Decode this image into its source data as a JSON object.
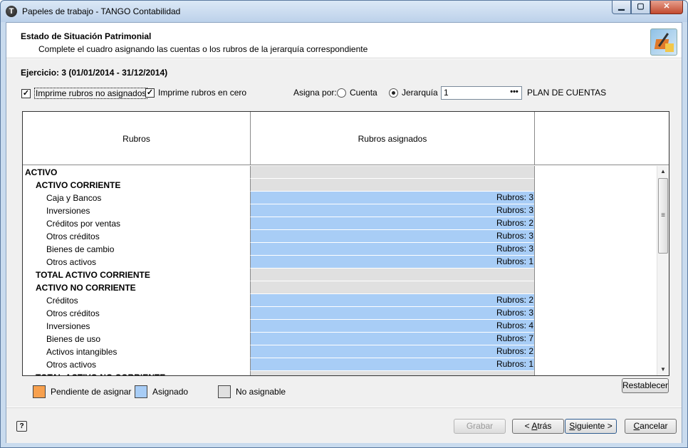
{
  "window": {
    "title": "Papeles de trabajo - TANGO Contabilidad",
    "icon": "tango-app-icon",
    "controls": {
      "minimize": "▁",
      "maximize": "▢",
      "close": "✕"
    }
  },
  "header": {
    "title": "Estado de Situación Patrimonial",
    "subtitle": "Complete el cuadro asignando las cuentas o los rubros de la jerarquía correspondiente"
  },
  "ejercicio": "Ejercicio: 3 (01/01/2014 - 31/12/2014)",
  "options": {
    "imprime_no_asignados": {
      "label": "Imprime rubros no asignados",
      "checked": true,
      "mark": "✓"
    },
    "imprime_en_cero": {
      "label": "Imprime rubros en cero",
      "checked": true,
      "mark": "✓"
    },
    "asigna_por_label": "Asigna por:",
    "radio_cuenta": {
      "label": "Cuenta",
      "selected": false
    },
    "radio_jerarquia": {
      "label": "Jerarquía",
      "selected": true
    },
    "jerarquia_value": "1",
    "jerarquia_button": "•••",
    "plan_label": "PLAN DE CUENTAS"
  },
  "grid": {
    "columns": [
      "Rubros",
      "Rubros asignados",
      ""
    ],
    "rows": [
      {
        "name": "ACTIVO",
        "level": 0,
        "bold": true,
        "value": "",
        "status": "none"
      },
      {
        "name": "ACTIVO CORRIENTE",
        "level": 1,
        "bold": true,
        "value": "",
        "status": "none"
      },
      {
        "name": "Caja y Bancos",
        "level": 2,
        "bold": false,
        "value": "Rubros: 3",
        "status": "assigned"
      },
      {
        "name": "Inversiones",
        "level": 2,
        "bold": false,
        "value": "Rubros: 3",
        "status": "assigned"
      },
      {
        "name": "Créditos por ventas",
        "level": 2,
        "bold": false,
        "value": "Rubros: 2",
        "status": "assigned"
      },
      {
        "name": "Otros créditos",
        "level": 2,
        "bold": false,
        "value": "Rubros: 3",
        "status": "assigned"
      },
      {
        "name": "Bienes de cambio",
        "level": 2,
        "bold": false,
        "value": "Rubros: 3",
        "status": "assigned"
      },
      {
        "name": "Otros activos",
        "level": 2,
        "bold": false,
        "value": "Rubros: 1",
        "status": "assigned"
      },
      {
        "name": "TOTAL ACTIVO CORRIENTE",
        "level": 1,
        "bold": true,
        "value": "",
        "status": "none"
      },
      {
        "name": "ACTIVO NO CORRIENTE",
        "level": 1,
        "bold": true,
        "value": "",
        "status": "none"
      },
      {
        "name": "Créditos",
        "level": 2,
        "bold": false,
        "value": "Rubros: 2",
        "status": "assigned"
      },
      {
        "name": "Otros créditos",
        "level": 2,
        "bold": false,
        "value": "Rubros: 3",
        "status": "assigned"
      },
      {
        "name": "Inversiones",
        "level": 2,
        "bold": false,
        "value": "Rubros: 4",
        "status": "assigned"
      },
      {
        "name": "Bienes de uso",
        "level": 2,
        "bold": false,
        "value": "Rubros: 7",
        "status": "assigned"
      },
      {
        "name": "Activos intangibles",
        "level": 2,
        "bold": false,
        "value": "Rubros: 2",
        "status": "assigned"
      },
      {
        "name": "Otros activos",
        "level": 2,
        "bold": false,
        "value": "Rubros: 1",
        "status": "assigned"
      },
      {
        "name": "TOTAL ACTIVO NO CORRIENTE",
        "level": 1,
        "bold": true,
        "value": "",
        "status": "none"
      }
    ],
    "scroll": {
      "up": "▲",
      "down": "▼",
      "thumb_grip": "≡"
    }
  },
  "legend": [
    {
      "label": "Pendiente de asignar",
      "color": "#f7a04e"
    },
    {
      "label": "Asignado",
      "color": "#a8cdf6"
    },
    {
      "label": "No asignable",
      "color": "#e0e0e0"
    }
  ],
  "buttons": {
    "restablecer": "Restablecer",
    "help": "?",
    "grabar": {
      "label": "Grabar",
      "enabled": false
    },
    "atras": {
      "prefix": "< ",
      "accel": "A",
      "rest": "trás"
    },
    "siguiente": {
      "accel": "S",
      "rest": "iguiente",
      "suffix": " >"
    },
    "cancelar": {
      "accel": "C",
      "rest": "ancelar"
    }
  }
}
